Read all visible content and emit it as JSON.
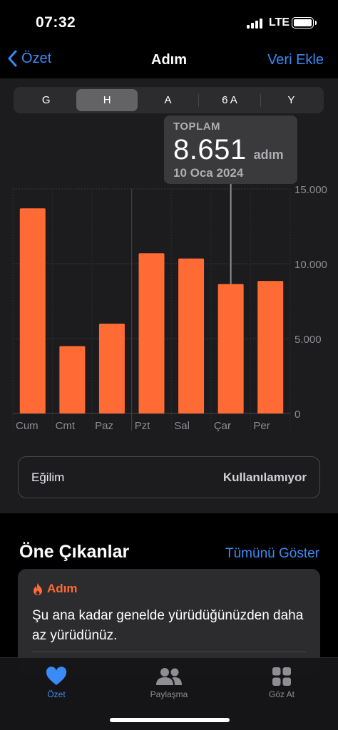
{
  "status": {
    "time": "07:32",
    "network": "LTE"
  },
  "nav": {
    "back_label": "Özet",
    "title": "Adım",
    "add_label": "Veri Ekle"
  },
  "segments": [
    "G",
    "H",
    "A",
    "6 A",
    "Y"
  ],
  "selected_segment": "H",
  "tooltip": {
    "label": "TOPLAM",
    "value": "8.651",
    "unit": "adım",
    "date": "10 Oca 2024"
  },
  "chart_data": {
    "type": "bar",
    "categories": [
      "Cum",
      "Cmt",
      "Paz",
      "Pzt",
      "Sal",
      "Çar",
      "Per"
    ],
    "values": [
      13700,
      4500,
      6000,
      10700,
      10350,
      8651,
      8850
    ],
    "ylim": [
      0,
      15000
    ],
    "yticks": [
      0,
      5000,
      10000,
      15000
    ],
    "ytick_labels": [
      "0",
      "5.000",
      "10.000",
      "15.000"
    ],
    "selected_index": 5,
    "bar_color": "#ff6a35",
    "grid": true
  },
  "trend": {
    "label": "Eğilim",
    "value": "Kullanılamıyor"
  },
  "highlights": {
    "title": "Öne Çıkanlar",
    "show_all": "Tümünü Göster",
    "card": {
      "category": "Adım",
      "text": "Şu ana kadar genelde yürüdüğünüzden daha az yürüdünüz."
    }
  },
  "tabs": [
    {
      "label": "Özet",
      "icon": "heart-icon",
      "active": true
    },
    {
      "label": "Paylaşma",
      "icon": "people-icon",
      "active": false
    },
    {
      "label": "Göz At",
      "icon": "grid-icon",
      "active": false
    }
  ],
  "colors": {
    "accent": "#3a8bf5",
    "activity": "#ff6a35"
  }
}
